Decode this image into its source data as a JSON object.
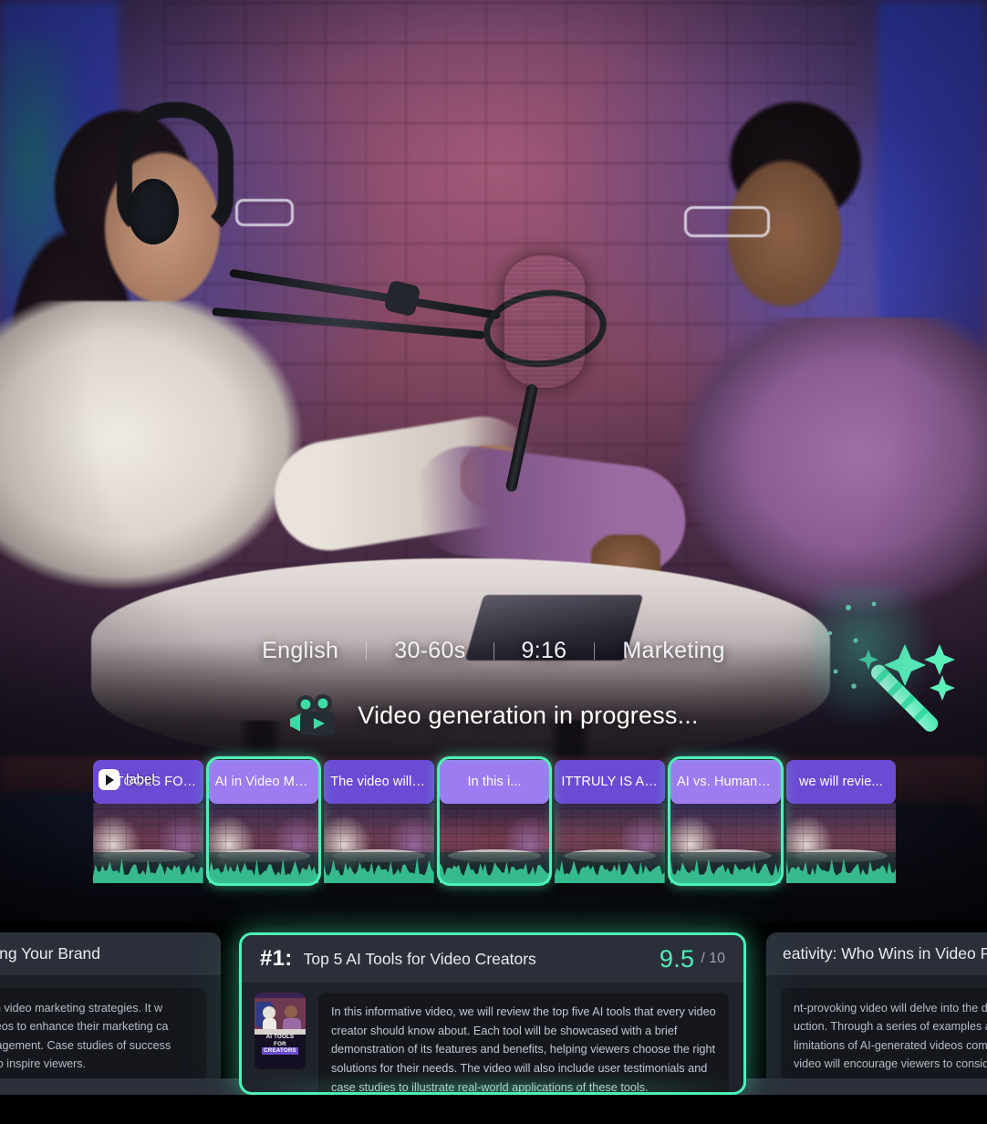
{
  "meta": {
    "items": [
      "English",
      "30-60s",
      "9:16",
      "Marketing"
    ]
  },
  "status": {
    "text": "Video generation in progress...",
    "icon": "video-camera-icon"
  },
  "decor": {
    "wand_icon": "magic-wand-icon",
    "accent_color": "#4ff0b7",
    "caption_color": "#6c4bd4",
    "caption_selected_color": "#9d7bf0"
  },
  "timeline": {
    "overlay_label": "label",
    "play_icon": "play-icon",
    "clips": [
      {
        "caption": "AI TOOLS FOR CREA...",
        "selected": false
      },
      {
        "caption": "AI in Video Mar...",
        "selected": true
      },
      {
        "caption": "The video will also",
        "selected": false
      },
      {
        "caption": "In this i...",
        "selected": true
      },
      {
        "caption": "ITTRULY IS AI MAGIC",
        "selected": false
      },
      {
        "caption": "AI vs. Human C...",
        "selected": true
      },
      {
        "caption": "we will revie...",
        "selected": false
      }
    ]
  },
  "ideas": {
    "left": {
      "title": "n Video Marketing: Boosting Your Brand",
      "description": "video will highlight the role of AI in video marketing strategies. It w nesses can use AI-generated videos to enhance their marketing ca ence targeting, and increase engagement. Case studies of success video marketing will be included to inspire viewers."
    },
    "center": {
      "rank": "#1:",
      "title": "Top 5 AI Tools for Video Creators",
      "score": "9.5",
      "score_max": "/ 10",
      "thumbnail_line1": "AI TOOLS",
      "thumbnail_line2": "FOR",
      "thumbnail_line3": "CREATORS",
      "description": "In this informative video, we will review the top five AI tools that every video creator should know about. Each tool will be showcased with a brief demonstration of its features and benefits, helping viewers choose the right solutions for their needs. The video will also include user testimonials and case studies to illustrate real-world applications of these tools."
    },
    "right": {
      "title": "eativity: Who Wins in Video Production?",
      "description": "nt-provoking video will delve into the debate between AI and huma uction. Through a series of examples and expert opinions, we will e nd limitations of AI-generated videos compared to traditional huma The video will encourage viewers to consider the implications of A"
    }
  }
}
